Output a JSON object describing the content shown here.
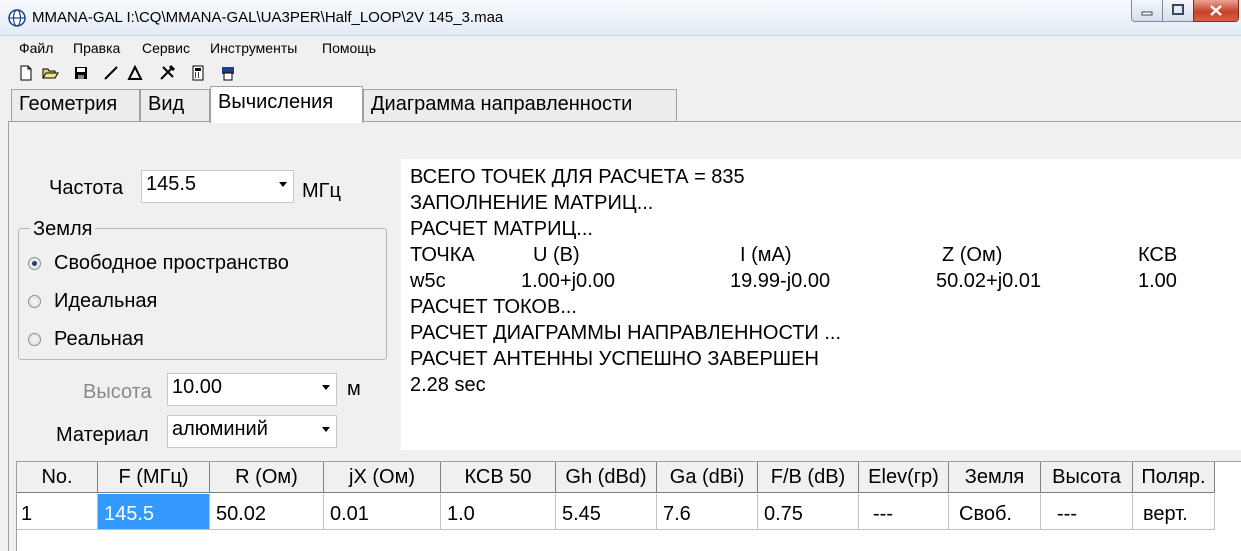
{
  "window": {
    "title": "MMANA-GAL I:\\CQ\\MMANA-GAL\\UA3PER\\Half_LOOP\\2V 145_3.maa"
  },
  "menu": [
    "Файл",
    "Правка",
    "Сервис",
    "Инструменты",
    "Помощь"
  ],
  "toolbar": [
    "new-file-icon",
    "open-folder-icon",
    "save-disk-icon",
    "line-tool-icon",
    "triangle-tool-icon",
    "tools-icon",
    "calculator-icon",
    "print-icon"
  ],
  "tabs": [
    {
      "label": "Геометрия",
      "active": false
    },
    {
      "label": "Вид",
      "active": false
    },
    {
      "label": "Вычисления",
      "active": true
    },
    {
      "label": "Диаграмма направленности",
      "active": false
    }
  ],
  "frequency": {
    "label": "Частота",
    "value": "145.5",
    "unit": "МГц"
  },
  "ground": {
    "legend": "Земля",
    "options": [
      {
        "label": "Свободное пространство",
        "selected": true
      },
      {
        "label": "Идеальная",
        "selected": false
      },
      {
        "label": "Реальная",
        "selected": false
      }
    ]
  },
  "height": {
    "label": "Высота",
    "value": "10.00",
    "unit": "м"
  },
  "material": {
    "label": "Материал",
    "value": "алюминий"
  },
  "log": {
    "lines": [
      "ВСЕГО ТОЧЕК ДЛЯ РАСЧЕТА = 835",
      "ЗАПОЛНЕНИЕ МАТРИЦ...",
      "РАСЧЕТ МАТРИЦ..."
    ],
    "table_header": [
      "ТОЧКА",
      "U (В)",
      "I (мА)",
      "Z (Ом)",
      "КСВ"
    ],
    "table_row": [
      "w5c",
      "1.00+j0.00",
      "19.99-j0.00",
      "50.02+j0.01",
      "1.00"
    ],
    "lines_after": [
      "РАСЧЕТ ТОКОВ...",
      "РАСЧЕТ ДИАГРАММЫ НАПРАВЛЕННОСТИ ...",
      "РАСЧЕТ АНТЕННЫ УСПЕШНО ЗАВЕРШЕН",
      "2.28 sec"
    ]
  },
  "results": {
    "columns": [
      "No.",
      "F (МГц)",
      "R (Ом)",
      "jX (Ом)",
      "КСВ 50",
      "Gh (dBd)",
      "Ga (dBi)",
      "F/B (dB)",
      "Elev(гр)",
      "Земля",
      "Высота",
      "Поляр."
    ],
    "rows": [
      [
        "1",
        "145.5",
        "50.02",
        "0.01",
        "1.0",
        "5.45",
        "7.6",
        "0.75",
        "---",
        "Своб.",
        "---",
        "верт."
      ]
    ]
  },
  "colors": {
    "selection": "#3399ff",
    "window_bg": "#f0f0f0"
  }
}
